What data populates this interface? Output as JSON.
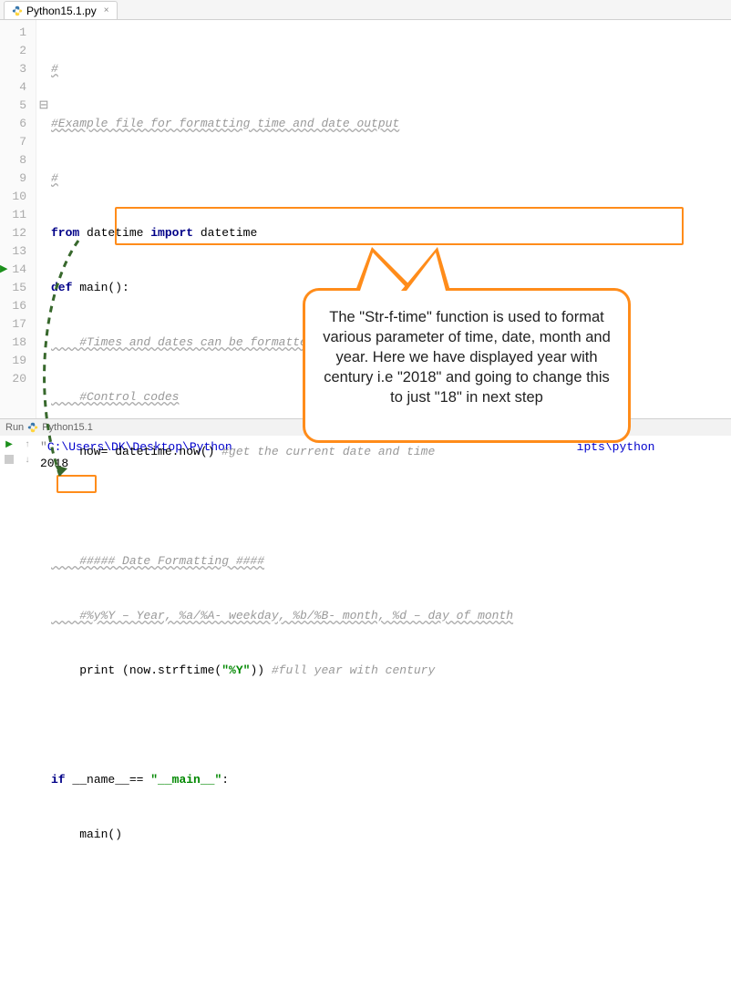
{
  "tab": {
    "icon": "python-file-icon",
    "label": "Python15.1.py",
    "close": "×"
  },
  "lines": {
    "count": 20,
    "numbers": [
      "1",
      "2",
      "3",
      "4",
      "5",
      "6",
      "7",
      "8",
      "9",
      "10",
      "11",
      "12",
      "13",
      "14",
      "15",
      "16",
      "17",
      "18",
      "19",
      "20"
    ]
  },
  "code": {
    "l1": "#",
    "l2": "#Example file for formatting time and date output",
    "l3": "#",
    "l4_from": "from",
    "l4_mod": " datetime ",
    "l4_import": "import",
    "l4_name": " datetime",
    "l5_def": "def",
    "l5_name": " main():",
    "l6": "    #Times and dates can be formatted using a set of predefined string",
    "l7": "    #Control codes",
    "l8_a": "    now= datetime.now() ",
    "l8_c": "#get the current date and time",
    "l10": "    ##### Date Formatting ####",
    "l11": "    #%y%Y – Year, %a/%A- weekday, %b/%B- month, %d – day of month",
    "l12_a": "    print (now.strftime(",
    "l12_s": "\"%Y\"",
    "l12_b": ")) ",
    "l12_c": "#full year with century",
    "l14_if": "if",
    "l14_mid": " __name__== ",
    "l14_s": "\"__main__\"",
    "l14_colon": ":",
    "l15": "    main()"
  },
  "run": {
    "label": "Run",
    "config": "Python15.1"
  },
  "console": {
    "path_prefix": "\"",
    "path_tail": "ipts\\python",
    "path": "C:\\Users\\DK\\Desktop\\Python",
    "output": "2018"
  },
  "callout": {
    "text": "The \"Str-f-time\" function is used to format various parameter of time, date, month and year. Here we have displayed year with century i.e \"2018\" and going to change this to just \"18\" in next step"
  },
  "colors": {
    "accent": "#ff8c1a",
    "dash": "#37682c"
  }
}
